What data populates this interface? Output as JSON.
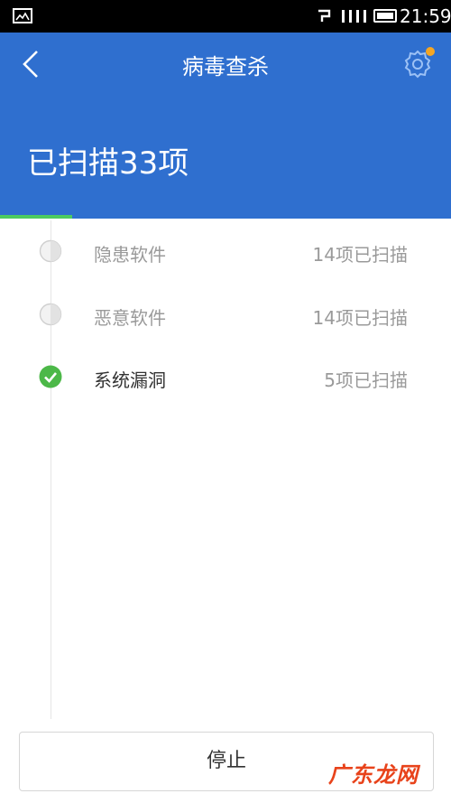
{
  "status_bar": {
    "time": "21:59"
  },
  "header": {
    "title": "病毒查杀",
    "scanned_text": "已扫描33项",
    "progress_fraction": 0.16
  },
  "items": [
    {
      "label": "隐患软件",
      "count": "14项已扫描",
      "state": "pending"
    },
    {
      "label": "恶意软件",
      "count": "14项已扫描",
      "state": "pending"
    },
    {
      "label": "系统漏洞",
      "count": "5项已扫描",
      "state": "done"
    }
  ],
  "stop_label": "停止",
  "watermark": "广东龙网",
  "colors": {
    "header": "#2f6fcf",
    "progress": "#4ccb60",
    "check": "#4cb848",
    "badge": "#f5a623"
  },
  "icons": {
    "back": "chevron-left-icon",
    "settings": "gear-icon",
    "pending": "spinner-icon",
    "done": "check-circle-icon"
  }
}
